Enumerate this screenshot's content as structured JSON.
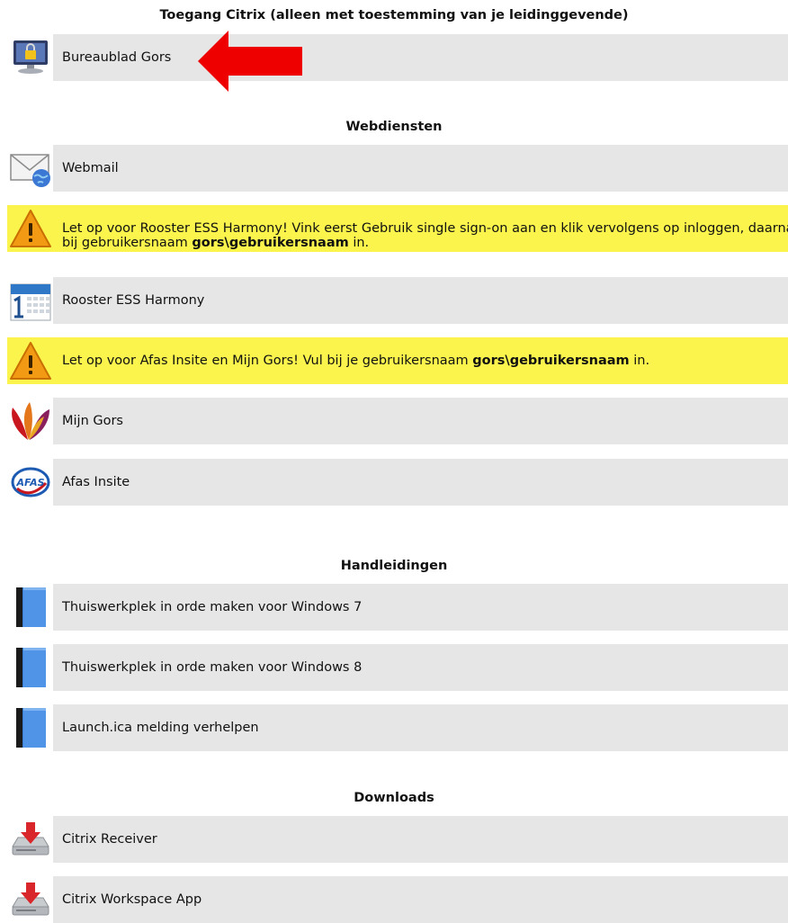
{
  "sections": {
    "citrix": "Toegang Citrix (alleen met toestemming van je leidinggevende)",
    "web": "Webdiensten",
    "manuals": "Handleidingen",
    "downloads": "Downloads"
  },
  "items": {
    "bureaublad": "Bureaublad Gors",
    "webmail": "Webmail",
    "rooster": "Rooster ESS Harmony",
    "mijngors": "Mijn Gors",
    "afas": "Afas Insite",
    "win7": "Thuiswerkplek in orde maken voor Windows 7",
    "win8": "Thuiswerkplek in orde maken voor Windows 8",
    "launch": "Launch.ica melding verhelpen",
    "receiver": "Citrix Receiver",
    "workspace": "Citrix Workspace App"
  },
  "warnings": {
    "rooster": {
      "line1": "Let op voor Rooster ESS Harmony! Vink eerst Gebruik single sign-on aan en klik vervolgens op inloggen, daarna vul je",
      "line2_pre": "bij gebruikersnaam ",
      "line2_bold": "gors\\gebruikersnaam",
      "line2_post": " in."
    },
    "afas": {
      "pre": "Let op voor Afas Insite en Mijn Gors! Vul bij je gebruikersnaam ",
      "bold": "gors\\gebruikersnaam",
      "post": " in."
    }
  },
  "icons": {
    "afas_logo_text": "AFAS"
  },
  "colors": {
    "row_bg": "#e6e6e6",
    "warning_bg": "#fbf44c",
    "arrow": "#ee0000"
  }
}
